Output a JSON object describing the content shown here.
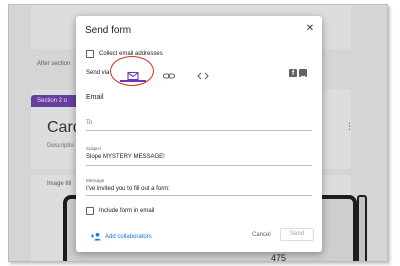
{
  "background": {
    "after_section_text": "After section",
    "section_tab_label": "Section 2 o",
    "card_title": "Caro",
    "card_description": "Descriptio",
    "image_title": "Image titl",
    "image_number": "475"
  },
  "dialog": {
    "title": "Send form",
    "close_icon": "close-icon",
    "collect_emails_label": "Collect email addresses",
    "send_via_label": "Send via",
    "send_via_tabs": [
      {
        "name": "email",
        "icon": "envelope-icon",
        "selected": true
      },
      {
        "name": "link",
        "icon": "link-icon",
        "selected": false
      },
      {
        "name": "embed",
        "icon": "code-icon",
        "selected": false
      }
    ],
    "social": [
      "facebook-icon",
      "twitter-icon"
    ],
    "email_section_title": "Email",
    "to_placeholder": "To",
    "subject_label": "Subject",
    "subject_value": "Slope MYSTERY MESSAGE!",
    "message_label": "Message",
    "message_value": "I've invited you to fill out a form:",
    "include_form_label": "Include form in email",
    "add_collaborators_label": "Add collaborators",
    "cancel_label": "Cancel",
    "send_label": "Send"
  },
  "colors": {
    "accent": "#673ab7",
    "annotation_circle": "#d62a2a",
    "link_blue": "#1a73e8"
  }
}
